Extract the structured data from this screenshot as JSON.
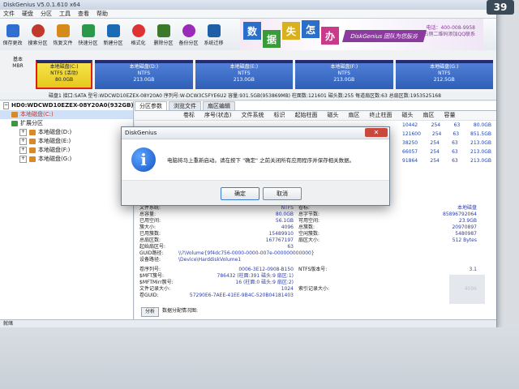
{
  "app": {
    "title": "DiskGenius V5.0.1.610 x64"
  },
  "menu": [
    "文件",
    "硬盘",
    "分区",
    "工具",
    "查看",
    "帮助"
  ],
  "toolbar": [
    {
      "label": "保存更改",
      "icon": "save-icon",
      "color": "#2e6fd0"
    },
    {
      "label": "搜索分区",
      "icon": "search-icon",
      "color": "#c0392b"
    },
    {
      "label": "恢复文件",
      "icon": "recover-icon",
      "color": "#d68a1a"
    },
    {
      "label": "快速分区",
      "icon": "quick-partition-icon",
      "color": "#2a9a4a"
    },
    {
      "label": "新建分区",
      "icon": "new-partition-icon",
      "color": "#1a6ab5"
    },
    {
      "label": "格式化",
      "icon": "format-icon",
      "color": "#d33"
    },
    {
      "label": "删除分区",
      "icon": "delete-icon",
      "color": "#3b7a2a"
    },
    {
      "label": "备份分区",
      "icon": "backup-icon",
      "color": "#9a2ab8"
    },
    {
      "label": "系统迁移",
      "icon": "migrate-icon",
      "color": "#1e5fa8"
    }
  ],
  "banner": {
    "blocks": [
      "数",
      "据",
      "失",
      "怎",
      "办"
    ],
    "block_colors": [
      "#2a6fc9",
      "#3b9a3b",
      "#d8b21e",
      "#2a6fc9",
      "#c93b8a"
    ],
    "tag": "DiskGenius 团队为您服务",
    "phone": "电话：400-008-9958",
    "qq": "请扫描右侧二维码添加QQ联系"
  },
  "diskbar": {
    "basic": [
      "基本",
      "MBR"
    ],
    "partitions": [
      {
        "name": "本地磁盘(C:)",
        "fs": "NTFS (活动)",
        "size": "80.0GB",
        "selected": true
      },
      {
        "name": "本地磁盘(D:)",
        "fs": "NTFS",
        "size": "213.0GB",
        "selected": false
      },
      {
        "name": "本地磁盘(E:)",
        "fs": "NTFS",
        "size": "213.0GB",
        "selected": false
      },
      {
        "name": "本地磁盘(F:)",
        "fs": "NTFS",
        "size": "213.0GB",
        "selected": false
      },
      {
        "name": "本地磁盘(G:)",
        "fs": "NTFS",
        "size": "212.5GB",
        "selected": false
      }
    ]
  },
  "diskinfo": "磁盘1 接口:SATA 型号:WDCWD10EZEX-08Y20A0 序列号:W-DCW3C5FYE6U2 容量:931.5GB(953869MB) 柱面数:121601 磁头数:255 每道扇区数:63 总扇区数:1953525168",
  "tree": {
    "disk": "HD0:WDCWD10EZEX-08Y20A0(932GB)",
    "items": [
      {
        "label": "本地磁盘(C:)",
        "level": 1
      },
      {
        "label": "扩展分区",
        "level": 1
      },
      {
        "label": "本地磁盘(D:)",
        "level": 2
      },
      {
        "label": "本地磁盘(E:)",
        "level": 2
      },
      {
        "label": "本地磁盘(F:)",
        "level": 2
      },
      {
        "label": "本地磁盘(G:)",
        "level": 2
      }
    ]
  },
  "tabs": [
    "分区参数",
    "浏览文件",
    "扇区编辑"
  ],
  "columns": [
    "卷标",
    "序号(状态)",
    "文件系统",
    "标识",
    "起始柱面",
    "磁头",
    "扇区",
    "终止柱面",
    "磁头",
    "扇区",
    "容量"
  ],
  "rows": [
    {
      "c1": "10442",
      "c2": "254",
      "c3": "63",
      "cap": "80.0GB"
    },
    {
      "c1": "121600",
      "c2": "254",
      "c3": "63",
      "cap": "851.5GB"
    },
    {
      "c1": "38250",
      "c2": "254",
      "c3": "63",
      "cap": "213.0GB"
    },
    {
      "c1": "66057",
      "c2": "254",
      "c3": "63",
      "cap": "213.0GB"
    },
    {
      "c1": "91864",
      "c2": "254",
      "c3": "63",
      "cap": "213.0GB"
    }
  ],
  "details": [
    {
      "k": "文件系统:",
      "v": "NTFS",
      "k2": "卷标:",
      "v2": "本地磁盘"
    },
    {
      "k": "总容量:",
      "v": "80.0GB",
      "k2": "总字节数:",
      "v2": "85896792064"
    },
    {
      "k": "已用空间:",
      "v": "56.1GB",
      "k2": "可用空间:",
      "v2": "23.9GB"
    },
    {
      "k": "簇大小:",
      "v": "4096",
      "k2": "总簇数:",
      "v2": "20970897"
    },
    {
      "k": "已用簇数:",
      "v": "15489910",
      "k2": "空闲簇数:",
      "v2": "5480987"
    },
    {
      "k": "总扇区数:",
      "v": "167767197",
      "k2": "扇区大小:",
      "v2": "512 Bytes"
    },
    {
      "k": "起始扇区号:",
      "v": "63",
      "k2": "",
      "v2": ""
    },
    {
      "k": "GUID路径:",
      "v": "\\\\?\\Volume{9f4dc756-0000-0000-007e-000000000000}",
      "k2": "",
      "v2": ""
    },
    {
      "k": "设备路径:",
      "v": "\\Device\\HarddiskVolume1",
      "k2": "",
      "v2": ""
    },
    {
      "k": "卷序列号:",
      "v": "0006-3E12-0908-B150",
      "k2": "NTFS版本号:",
      "v2": "3.1"
    },
    {
      "k": "$MFT簇号:",
      "v": "786432 (柱面:391 磁头:9 扇区:1)",
      "k2": "",
      "v2": ""
    },
    {
      "k": "$MFTMirr簇号:",
      "v": "16 (柱面:0 磁头:9 扇区:2)",
      "k2": "",
      "v2": ""
    },
    {
      "k": "文件记录大小:",
      "v": "1024",
      "k2": "索引记录大小:",
      "v2": "4096"
    },
    {
      "k": "卷GUID:",
      "v": "57290E6-7AEE-41EE-9B4C-520B04181403",
      "k2": "",
      "v2": ""
    }
  ],
  "bottom_buttons": [
    "分析",
    "数据分配情况图:"
  ],
  "status": "就绪",
  "clock": "39",
  "dialog": {
    "title": "DiskGenius",
    "message": "电脑将马上重新启动。请在按下 \"确定\" 之前关闭所有应用程序并保存相关数据。",
    "ok": "确定",
    "cancel": "取消"
  }
}
